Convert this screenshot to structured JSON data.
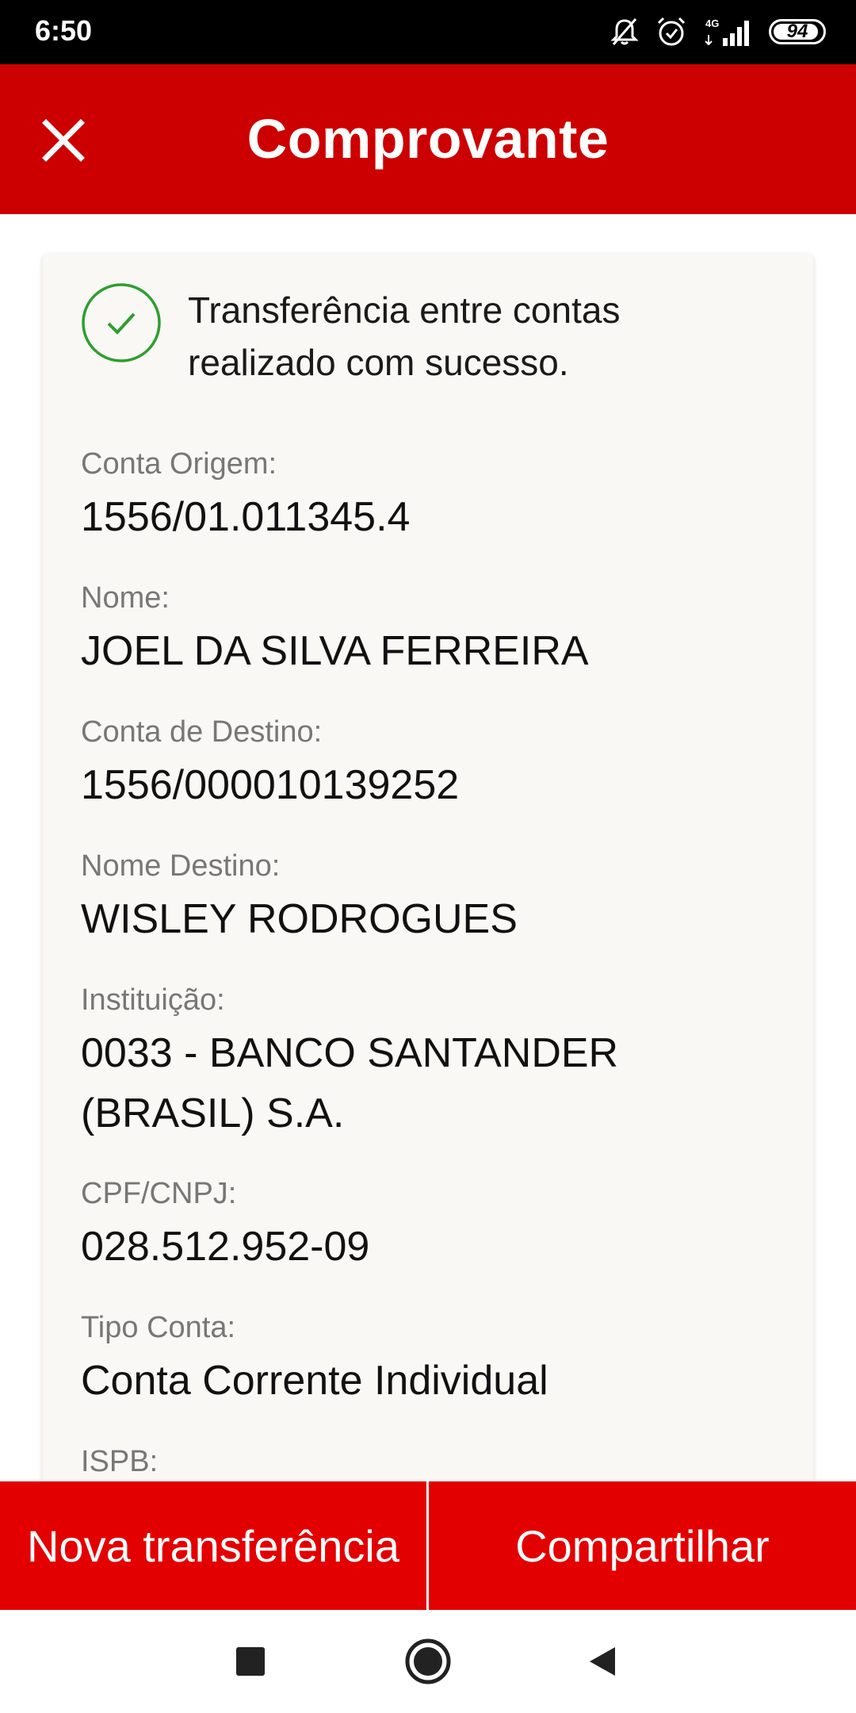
{
  "status_bar": {
    "time": "6:50",
    "network": "4G",
    "battery": "94",
    "battery_level": 0.94,
    "icons": [
      "bell-off-icon",
      "alarm-icon",
      "signal-icon",
      "battery-icon"
    ]
  },
  "app_bar": {
    "title": "Comprovante",
    "close_icon": "close-icon"
  },
  "card": {
    "success_message": "Transferência entre contas realizado com sucesso.",
    "success_icon": "check-circle-icon",
    "fields": [
      {
        "label": "Conta Origem:",
        "value": "1556/01.011345.4"
      },
      {
        "label": "Nome:",
        "value": "JOEL DA SILVA FERREIRA"
      },
      {
        "label": "Conta de Destino:",
        "value": "1556/000010139252"
      },
      {
        "label": "Nome Destino:",
        "value": "WISLEY RODROGUES"
      },
      {
        "label": "Instituição:",
        "value": "0033 - BANCO SANTANDER (BRASIL) S.A."
      },
      {
        "label": "CPF/CNPJ:",
        "value": "028.512.952-09"
      },
      {
        "label": "Tipo Conta:",
        "value": "Conta Corrente Individual"
      },
      {
        "label": "ISPB:",
        "value": ""
      }
    ]
  },
  "actions": {
    "new_transfer": "Nova transferência",
    "share": "Compartilhar"
  },
  "nav_bar": {
    "icons": [
      "recents-icon",
      "home-icon",
      "back-icon"
    ]
  },
  "colors": {
    "app_bar": "#cc0000",
    "action_buttons": "#e30000",
    "success": "#2e9e2e",
    "card_background": "#f9f8f5"
  }
}
